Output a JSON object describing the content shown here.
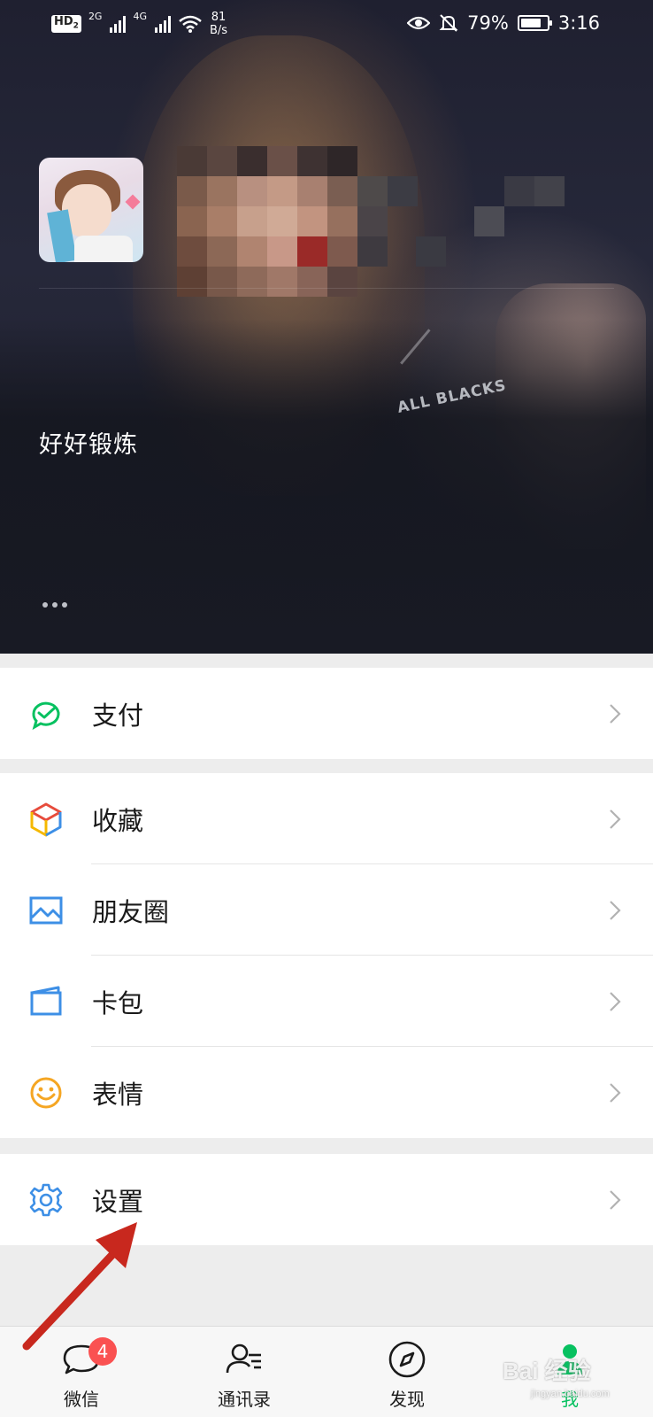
{
  "status_bar": {
    "hd": "HD",
    "hd_sub": "2",
    "net1": "2G",
    "net2": "4G",
    "speed_value": "81",
    "speed_unit": "B/s",
    "battery": "79%",
    "battery_level": 0.79,
    "time": "3:16"
  },
  "profile": {
    "signature": "好好锻炼",
    "cover_text": "ALL BLACKS"
  },
  "menu": {
    "group1": [
      {
        "label": "支付",
        "icon": "wallet-check-icon"
      }
    ],
    "group2": [
      {
        "label": "收藏",
        "icon": "cube-icon"
      },
      {
        "label": "朋友圈",
        "icon": "picture-icon"
      },
      {
        "label": "卡包",
        "icon": "card-icon"
      },
      {
        "label": "表情",
        "icon": "smiley-icon"
      }
    ],
    "group3": [
      {
        "label": "设置",
        "icon": "gear-icon"
      }
    ]
  },
  "tabbar": {
    "tabs": [
      {
        "label": "微信",
        "icon": "chat-bubble-icon",
        "badge": "4"
      },
      {
        "label": "通讯录",
        "icon": "contacts-icon"
      },
      {
        "label": "发现",
        "icon": "compass-icon"
      },
      {
        "label": "我",
        "icon": "person-icon",
        "active": true
      }
    ]
  },
  "watermark": {
    "brand": "Bai 经验",
    "url": "jingyan.baidu.com"
  },
  "colors": {
    "accent_green": "#07c160",
    "badge_red": "#fa5151",
    "annotation_arrow": "#c8281e"
  }
}
